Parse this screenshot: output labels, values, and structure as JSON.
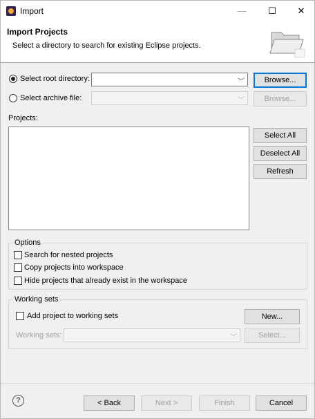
{
  "window": {
    "title": "Import",
    "minimize_glyph": "—",
    "maximize_glyph": "☐",
    "close_glyph": "✕"
  },
  "banner": {
    "title": "Import Projects",
    "description": "Select a directory to search for existing Eclipse projects."
  },
  "source": {
    "root_directory_label": "Select root directory:",
    "root_directory_value": "",
    "archive_file_label": "Select archive file:",
    "archive_file_value": "",
    "browse_root_label": "Browse...",
    "browse_archive_label": "Browse...",
    "selected": "root_directory",
    "dropdown_glyph": "﹀"
  },
  "projects": {
    "label": "Projects:",
    "items": [],
    "select_all_label": "Select All",
    "deselect_all_label": "Deselect All",
    "refresh_label": "Refresh"
  },
  "options": {
    "label": "Options",
    "items": [
      {
        "label": "Search for nested projects",
        "checked": false
      },
      {
        "label": "Copy projects into workspace",
        "checked": false
      },
      {
        "label": "Hide projects that already exist in the workspace",
        "checked": false
      }
    ]
  },
  "working_sets": {
    "label": "Working sets",
    "add_label": "Add project to working sets",
    "add_checked": false,
    "new_label": "New...",
    "sets_label": "Working sets:",
    "sets_value": "",
    "select_label": "Select..."
  },
  "footer": {
    "help_glyph": "?",
    "back_label": "< Back",
    "next_label": "Next >",
    "finish_label": "Finish",
    "cancel_label": "Cancel"
  },
  "colors": {
    "focus_border": "#0078d7",
    "disabled_text": "#a0a0a0"
  }
}
